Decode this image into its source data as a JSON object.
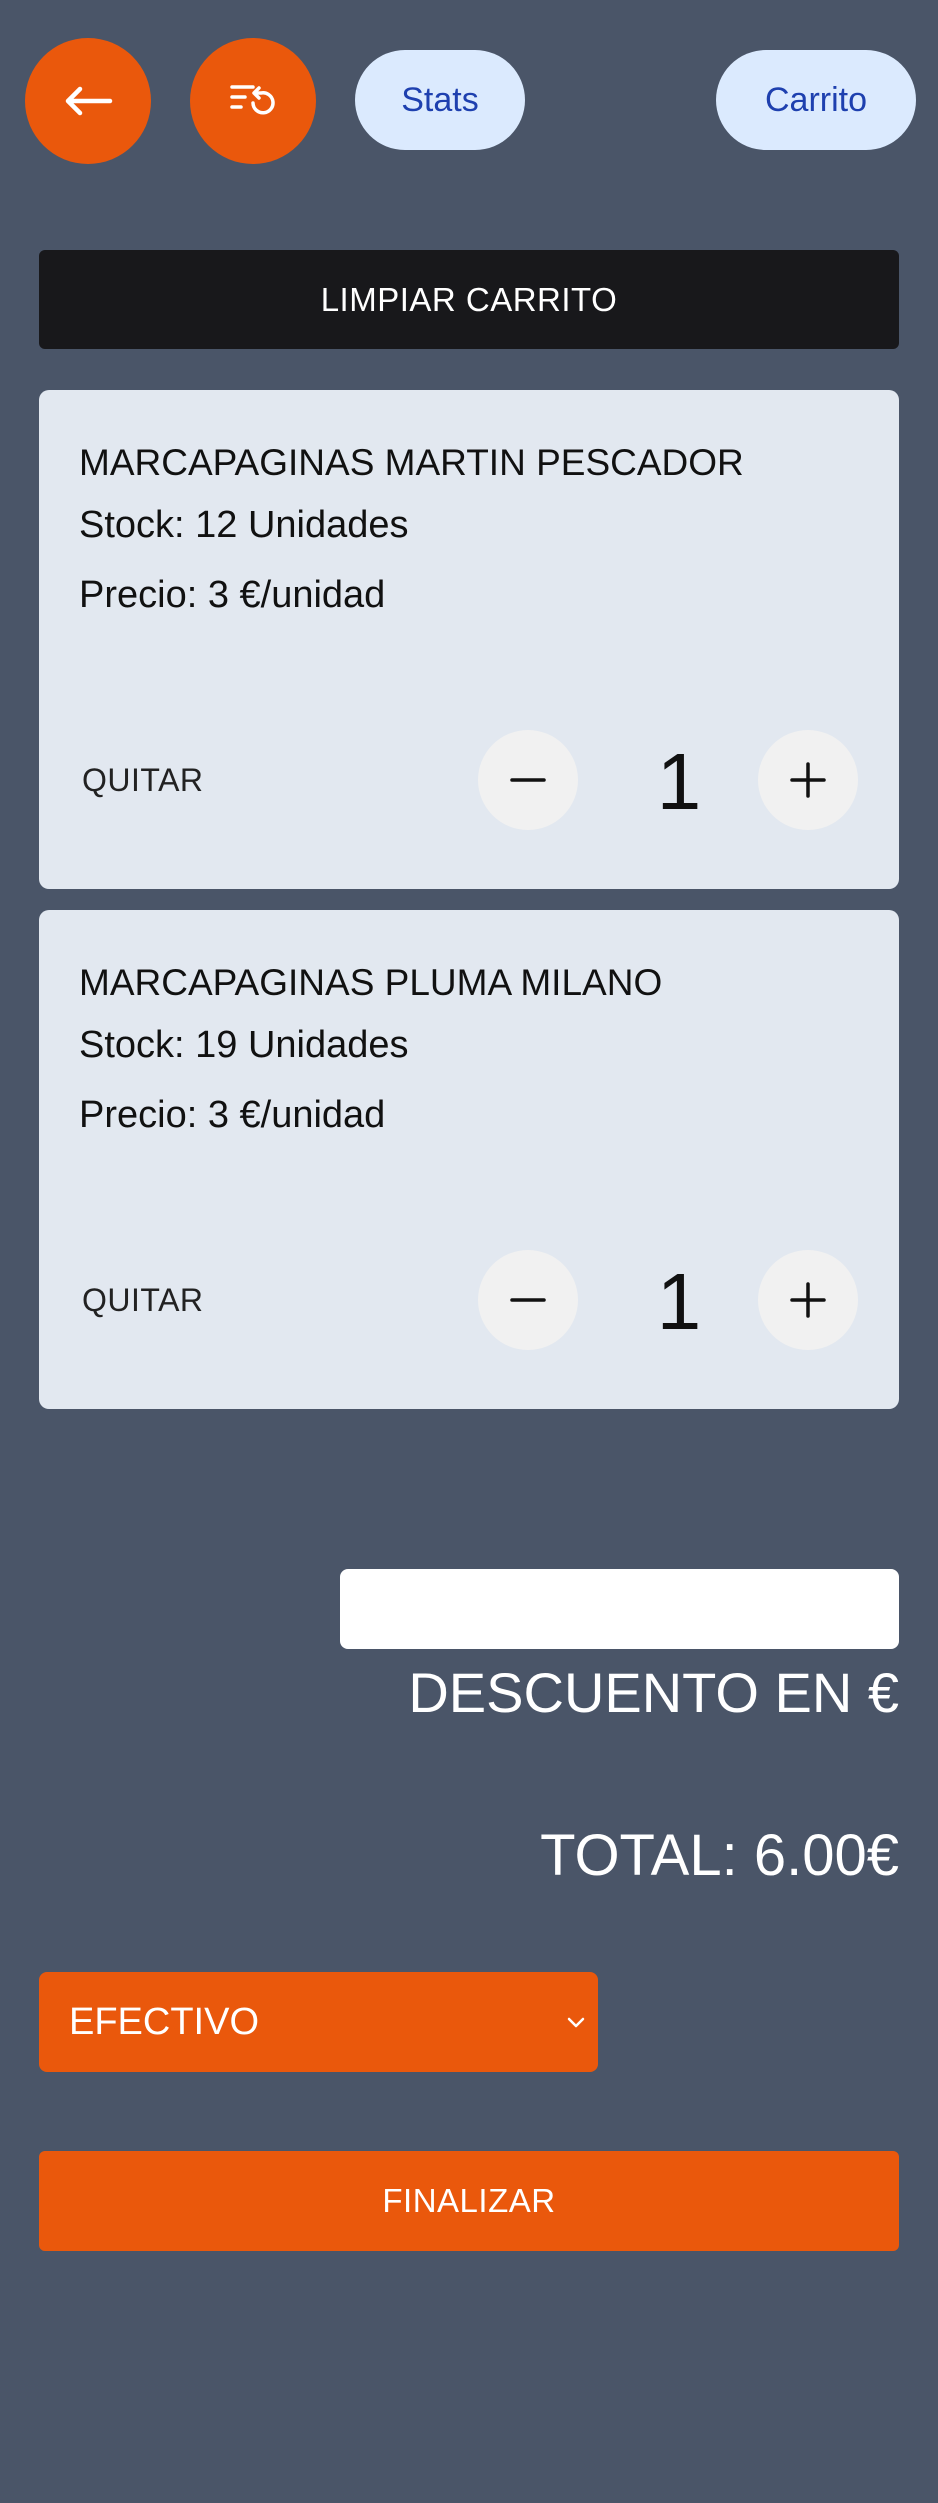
{
  "header": {
    "back_icon": "arrow-left-icon",
    "history_icon": "list-restart-icon",
    "stats_label": "Stats",
    "cart_label": "Carrito"
  },
  "clear_cart_label": "LIMPIAR CARRITO",
  "cart_items": [
    {
      "name": "MARCAPAGINAS MARTIN PESCADOR",
      "stock": "Stock: 12 Unidades",
      "price": "Precio: 3 €/unidad",
      "remove_label": "QUITAR",
      "quantity": "1"
    },
    {
      "name": "MARCAPAGINAS PLUMA MILANO",
      "stock": "Stock: 19 Unidades",
      "price": "Precio: 3 €/unidad",
      "remove_label": "QUITAR",
      "quantity": "1"
    }
  ],
  "discount": {
    "value": "",
    "label": "DESCUENTO EN €"
  },
  "total_label": "TOTAL: 6.00€",
  "payment_method": {
    "selected": "EFECTIVO"
  },
  "finish_label": "FINALIZAR",
  "colors": {
    "background": "#4a5568",
    "accent": "#ea580c",
    "pill_bg": "#dbeafe",
    "pill_text": "#1e40af",
    "card_bg": "#e2e8f0",
    "dark_button": "#18181b"
  }
}
